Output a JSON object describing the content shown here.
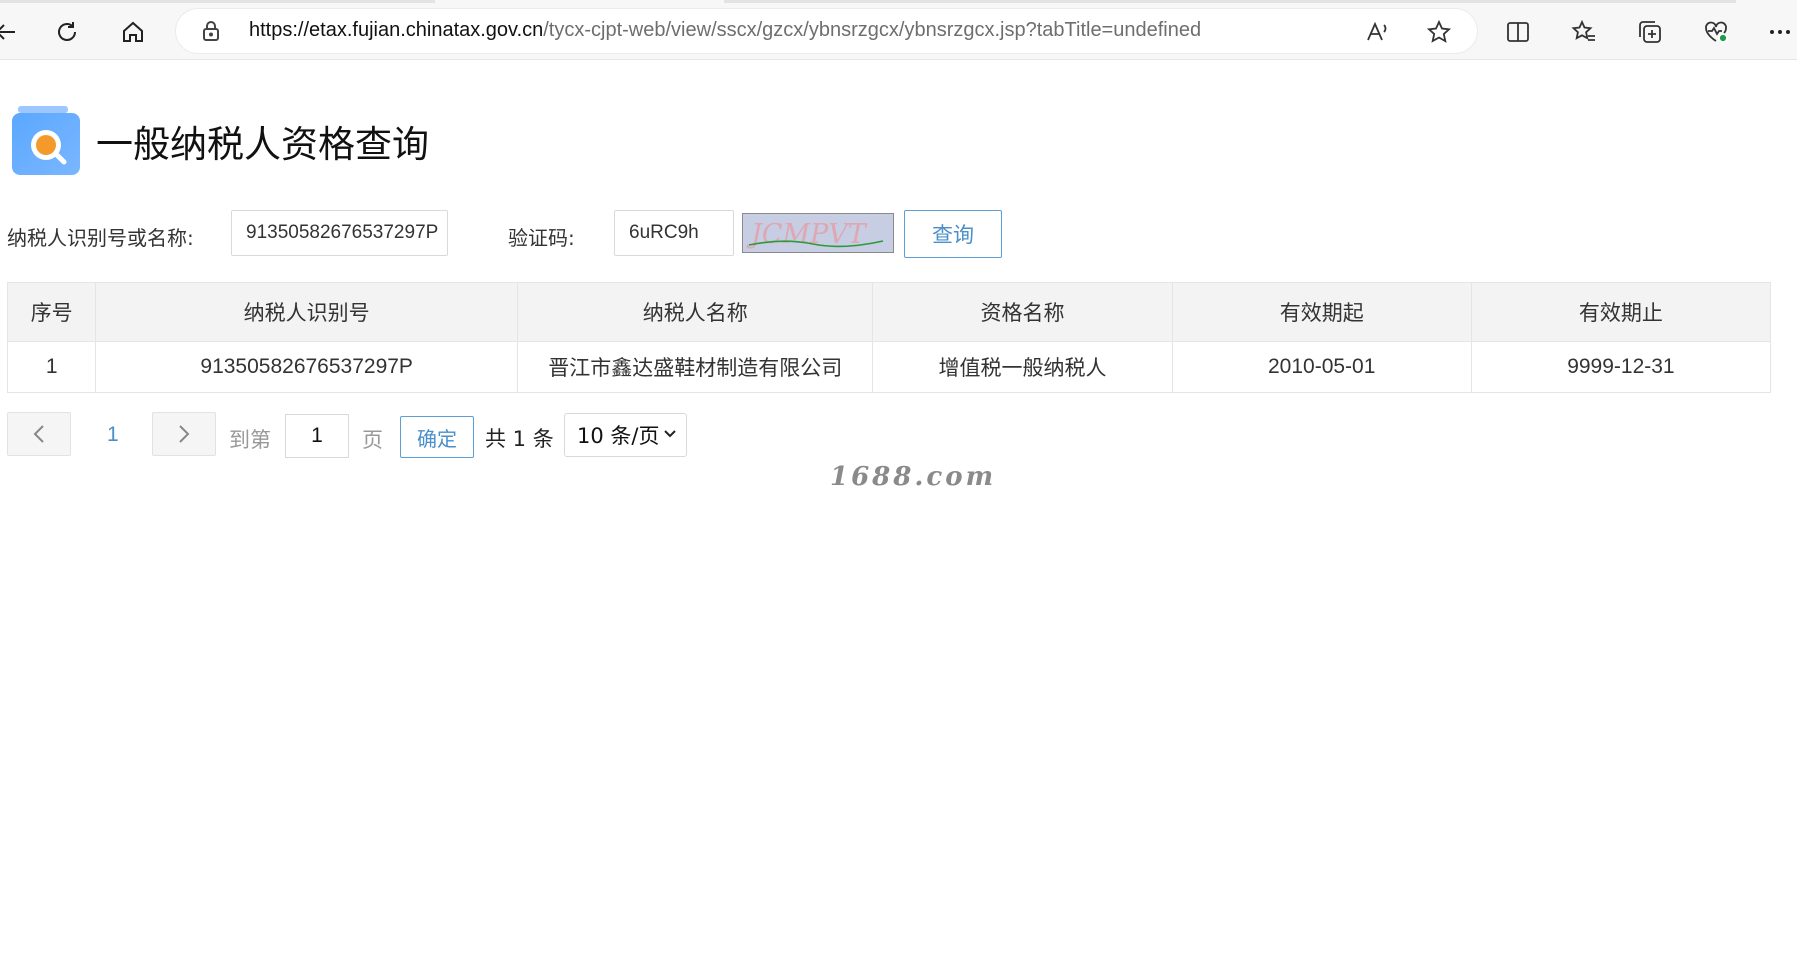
{
  "browser": {
    "url_host": "https://etax.fujian.chinatax.gov.cn",
    "url_path": "/tycx-cjpt-web/view/sscx/gzcx/ybnsrzgcx/ybnsrzgcx.jsp?tabTitle=undefined",
    "icons": [
      "back-icon",
      "refresh-icon",
      "home-icon",
      "lock-icon",
      "read-aloud-icon",
      "favorite-star-icon",
      "split-screen-icon",
      "favorites-icon",
      "collections-icon",
      "browser-essentials-icon",
      "more-icon"
    ]
  },
  "page": {
    "title": "一般纳税人资格查询"
  },
  "form": {
    "taxpayer_label": "纳税人识别号或名称:",
    "taxpayer_value": "91350582676537297P",
    "captcha_label": "验证码:",
    "captcha_value": "6uRC9h",
    "captcha_image_text": "JCMPVT",
    "query_button": "查询"
  },
  "table": {
    "headers": [
      "序号",
      "纳税人识别号",
      "纳税人名称",
      "资格名称",
      "有效期起",
      "有效期止"
    ],
    "rows": [
      [
        "1",
        "91350582676537297P",
        "晋江市鑫达盛鞋材制造有限公司",
        "增值税一般纳税人",
        "2010-05-01",
        "9999-12-31"
      ]
    ]
  },
  "pagination": {
    "current_page": "1",
    "goto_label": "到第",
    "goto_value": "1",
    "page_unit": "页",
    "confirm": "确定",
    "total": "共 1 条",
    "page_size": "10 条/页"
  },
  "watermark": "1688.com",
  "colors": {
    "accent": "#4a8fc9",
    "header_bg": "#f3f3f3",
    "border": "#e5e5e5"
  }
}
